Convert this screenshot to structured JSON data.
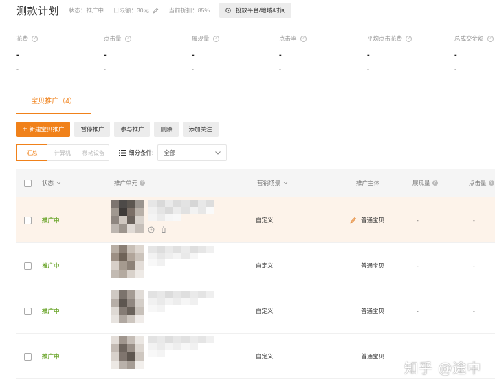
{
  "header": {
    "title": "测款计划",
    "status": "状态：推广中",
    "daily_budget": "日限额：30元",
    "discount": "当前折扣：85%",
    "settings_label": "投放平台/地域/时间"
  },
  "metrics": [
    {
      "label": "花费",
      "value": "-",
      "sub": "-"
    },
    {
      "label": "点击量",
      "value": "-",
      "sub": "-"
    },
    {
      "label": "展现量",
      "value": "-",
      "sub": "-"
    },
    {
      "label": "点击率",
      "value": "-",
      "sub": "-"
    },
    {
      "label": "平均点击花费",
      "value": "-",
      "sub": "-"
    },
    {
      "label": "总成交金额",
      "value": "-",
      "sub": "-"
    }
  ],
  "tabs": [
    {
      "label": "宝贝推广（4）"
    }
  ],
  "actions": {
    "new_item": "新建宝贝推广",
    "pause": "暂停推广",
    "resume": "参与推广",
    "delete": "删除",
    "follow": "添加关注"
  },
  "filters": {
    "segments": [
      "汇总",
      "计算机",
      "移动设备"
    ],
    "breakdown_label": "细分条件:",
    "breakdown_value": "全部"
  },
  "table": {
    "columns": {
      "status": "状态",
      "unit": "推广单元",
      "scene": "营销场景",
      "subject": "推广主体",
      "impressions": "展现量",
      "clicks": "点击量"
    },
    "rows": [
      {
        "status": "推广中",
        "scene": "自定义",
        "subject": "普通宝贝",
        "impressions": "-",
        "clicks": "-"
      },
      {
        "status": "推广中",
        "scene": "自定义",
        "subject": "普通宝贝",
        "impressions": "-",
        "clicks": "-"
      },
      {
        "status": "推广中",
        "scene": "自定义",
        "subject": "普通宝贝",
        "impressions": "-",
        "clicks": "-"
      },
      {
        "status": "推广中",
        "scene": "自定义",
        "subject": "普通宝贝",
        "impressions": "",
        "clicks": ""
      }
    ]
  },
  "watermark": "知乎 @途中",
  "colors": {
    "accent": "#f0811a",
    "status_green": "#6aa52a",
    "row_highlight": "#fdf3ea"
  }
}
